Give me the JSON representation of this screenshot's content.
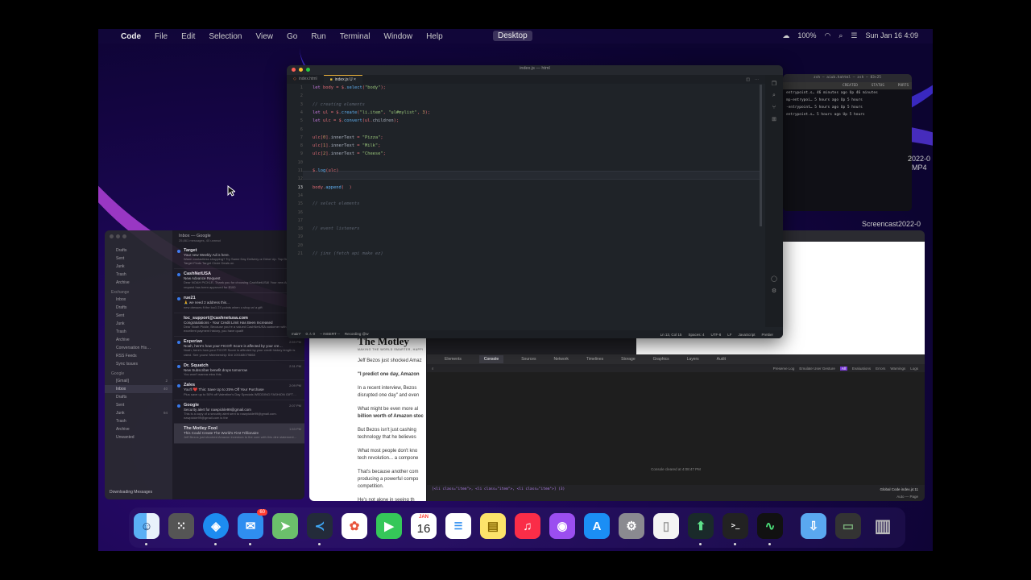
{
  "menubar": {
    "items": [
      "Code",
      "File",
      "Edit",
      "Selection",
      "View",
      "Go",
      "Run",
      "Terminal",
      "Window",
      "Help"
    ],
    "center": "Desktop",
    "battery": "100%",
    "clock": "Sun Jan 16  4:09"
  },
  "vscode": {
    "title": "index.js — html",
    "tabs": [
      {
        "label": "index.html"
      },
      {
        "label": "index.js U"
      }
    ],
    "lines": [
      "let body = $.select(\"body\");",
      "",
      "// creating elements",
      "let ul = $.create(\"li.item\", \"ul#mylist\", 3);",
      "let ulc = $.convert(ul.children);",
      "",
      "ulc[0].innerText = \"Pizza\";",
      "ulc[1].innerText = \"Milk\";",
      "ulc[2].innerText = \"Cheese\";",
      "",
      "$.log(ulc)",
      "",
      "body.append(  )",
      "",
      "// select elements",
      "",
      "",
      "// event listeners",
      "",
      "",
      "// jinx (fetch api make ez)"
    ],
    "status_left": [
      "main*",
      "0 ⚠ 0",
      "-- INSERT --",
      "Recording @w"
    ],
    "status_right": [
      "Ln 13, Col 15",
      "Spaces: 4",
      "UTF-8",
      "LF",
      "JavaScript",
      "Prettier"
    ]
  },
  "terminal": {
    "title": "zsh — aiub.hahtml — zsh — 83×25",
    "header": [
      "CREATED",
      "STATUS",
      "PORTS"
    ],
    "rows": [
      [
        "entrypoint.s…",
        "46 minutes ago",
        "Up 46 minutes"
      ],
      [
        "mp-entrypoi…",
        "5 hours ago",
        "Up 5 hours"
      ],
      [
        "-entrypoint…",
        "5 hours ago",
        "Up 5 hours"
      ],
      [
        "entrypoint.s…",
        "5 hours ago",
        "Up 5 hours"
      ]
    ]
  },
  "desktop_labels": [
    "2022-0",
    "MP4",
    "Screencast2022-0"
  ],
  "mail": {
    "mailbox": "Inbox — Google",
    "mailbox_sub": "25,861 messages, 40 unread",
    "sidebar_groups": [
      {
        "name": "",
        "items": [
          {
            "label": "Drafts",
            "count": ""
          },
          {
            "label": "Sent",
            "count": ""
          },
          {
            "label": "Junk",
            "count": ""
          },
          {
            "label": "Trash",
            "count": ""
          },
          {
            "label": "Archive",
            "count": ""
          }
        ]
      },
      {
        "name": "Exchange",
        "items": [
          {
            "label": "Inbox",
            "count": ""
          },
          {
            "label": "Drafts",
            "count": ""
          },
          {
            "label": "Sent",
            "count": ""
          },
          {
            "label": "Junk",
            "count": ""
          },
          {
            "label": "Trash",
            "count": ""
          },
          {
            "label": "Archive",
            "count": ""
          },
          {
            "label": "Conversation His…",
            "count": ""
          },
          {
            "label": "RSS Feeds",
            "count": ""
          },
          {
            "label": "Sync Issues",
            "count": ""
          }
        ]
      },
      {
        "name": "Google",
        "items": [
          {
            "label": "[Gmail]",
            "count": "2"
          },
          {
            "label": "Inbox",
            "count": "40"
          },
          {
            "label": "Drafts",
            "count": ""
          },
          {
            "label": "Sent",
            "count": ""
          },
          {
            "label": "Junk",
            "count": "94"
          },
          {
            "label": "Trash",
            "count": ""
          },
          {
            "label": "Archive",
            "count": ""
          },
          {
            "label": "Unwanted",
            "count": ""
          }
        ]
      }
    ],
    "footer": "Downloading Messages",
    "messages": [
      {
        "from": "Target",
        "time": "",
        "subject": "Your new Weekly Ad is here.",
        "preview": "Warm contactless shopping? Try Same Day Delivery or Drive Up. Top Deals Target Finds Target Circle Deals on",
        "unread": true
      },
      {
        "from": "CashNetUSA",
        "time": "",
        "subject": "New Advance Request",
        "preview": "Dear NOAH PICKLE, Thank you for choosing CashNetUSA! Your new Advance request has been approved for $100",
        "unread": true
      },
      {
        "from": "rue21",
        "time": "",
        "subject": "🙏 we need 2 address this...",
        "preview": "new dresses ft the loo1 2X points when u shop w/ a gift",
        "unread": true
      },
      {
        "from": "loc_support@cashnetusa.com",
        "time": "",
        "subject": "Congratulations - Your Credit Limit Has Been Increased",
        "preview": "Dear Noah Pickle, Because you're a valued CashNetUSA customer with an excellent payment history, you have qualif",
        "unread": false
      },
      {
        "from": "Experian",
        "time": "2:59 PM",
        "subject": "Noah, here's how your FICO® Score is affected by your cre…",
        "preview": "Noah, here's how your FICO® Score is affected by your credit history length is rated. See yours! Membership ID# 100168079868",
        "unread": true
      },
      {
        "from": "Dr. Squatch",
        "time": "2:31 PM",
        "subject": "New Subscriber benefit drops tomorrow",
        "preview": "You won't wanna miss this",
        "unread": true
      },
      {
        "from": "Zales",
        "time": "2:09 PM",
        "subject": "You'll ❤️ This: Save Up to 25% Off Your Purchase",
        "preview": "Plus save up to 50% off Valentine's Day Specials WEDDING FASHION GIFT…",
        "unread": true
      },
      {
        "from": "Google",
        "time": "2:07 PM",
        "subject": "Security alert for nawpickle99@gmail.com",
        "preview": "This is a copy of a security alert sent to nawpickle99@gmail.com. nawpickle99@gmail.com is the",
        "unread": true
      },
      {
        "from": "The Motley Fool",
        "time": "1:53 PM",
        "subject": "This Could Create The World's First Trillionaire",
        "preview": "Jeff Bezos just shocked Amazon investors to the core with this dire statement…",
        "unread": false
      }
    ]
  },
  "webpage": {
    "title": "The Motley",
    "tagline": "MAKING THE WORLD SMARTER, HAPPI",
    "paragraphs": [
      "Jeff Bezos just shocked Amaz",
      "\"I predict one day, Amazon",
      "In a recent interview, Bezos",
      "disrupted one day\" and even",
      "What might be even more al",
      "billion worth of Amazon stoc",
      "But Bezos isn't just cashing",
      "technology that he believes",
      "What most people don't kno",
      "tech revolution... a compone",
      "That's because another com",
      "producing a powerful compo",
      "competition.",
      "He's not alone in seeing th"
    ]
  },
  "devtools": {
    "tabs": [
      "Elements",
      "Console",
      "Sources",
      "Network",
      "Timelines",
      "Storage",
      "Graphics",
      "Layers",
      "Audit"
    ],
    "active_tab": "Console",
    "filter_left": "",
    "filter_right": [
      "Preserve Log",
      "Emulate User Gesture",
      "All",
      "Evaluations",
      "Errors",
      "Warnings",
      "Logs"
    ],
    "cleared": "Console cleared at 4:08:47 PM",
    "log_line": "[<li class=\"item\">, <li class=\"item\">, <li class=\"item\">] (3)",
    "global": "Global Code",
    "source": "index.js:11",
    "auto": "Auto — Page"
  },
  "dock": {
    "mail_badge": "60",
    "calendar_month": "JAN",
    "calendar_day": "16",
    "icons": [
      "finder-icon",
      "launchpad-icon",
      "safari-icon",
      "mail-icon",
      "maps-icon",
      "vscode-icon",
      "photos-icon",
      "facetime-icon",
      "calendar-icon",
      "reminders-icon",
      "notes-icon",
      "music-icon",
      "podcasts-icon",
      "appstore-icon",
      "settings-icon",
      "textedit-icon",
      "screencast-icon",
      "terminal-icon",
      "activity-monitor-icon",
      "downloads-icon",
      "desktop-stack-icon",
      "trash-icon"
    ]
  },
  "colors": {
    "vscode_bg": "#1f2328",
    "accent_purple": "#7a3ad8",
    "wallpaper": "#1a0650"
  }
}
